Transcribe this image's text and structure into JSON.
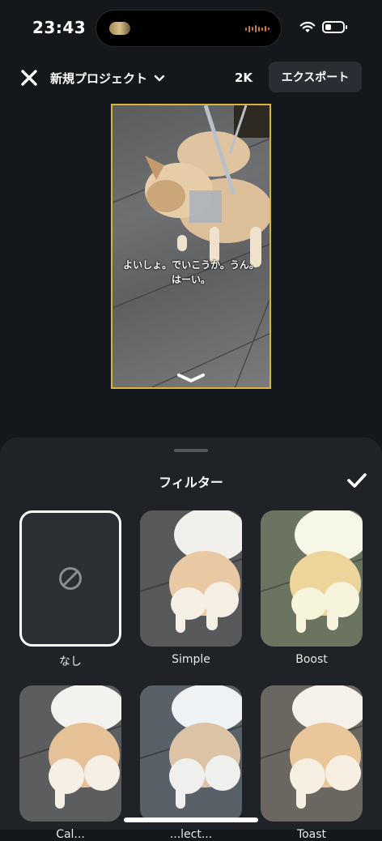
{
  "status_bar": {
    "time": "23:43",
    "battery_level": 0.35
  },
  "toolbar": {
    "project_title": "新規プロジェクト",
    "resolution": "2K",
    "export_label": "エクスポート"
  },
  "preview": {
    "subtitle": "よいしょ。でいこうか。うん。はーい。"
  },
  "filter_sheet": {
    "title": "フィルター",
    "filters": [
      {
        "label": "なし",
        "selected": true
      },
      {
        "label": "Simple",
        "selected": false
      },
      {
        "label": "Boost",
        "selected": false
      },
      {
        "label": "Cal...",
        "selected": false
      },
      {
        "label": "...lect...",
        "selected": false
      },
      {
        "label": "Toast",
        "selected": false
      }
    ]
  },
  "colors": {
    "accent_border": "#d9b43a",
    "background": "#14171b",
    "sheet": "#1f2226"
  }
}
